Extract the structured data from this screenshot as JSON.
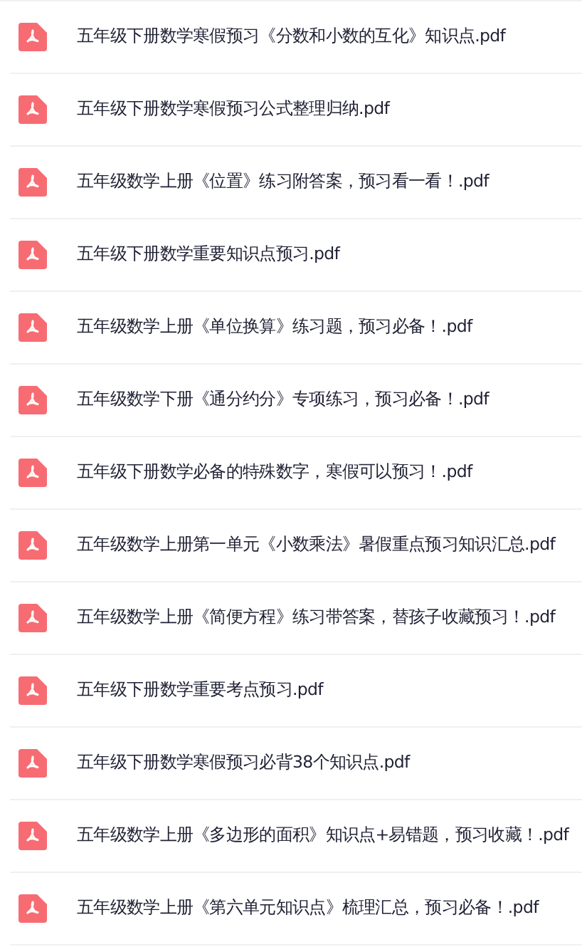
{
  "files": [
    {
      "name": "五年级下册数学寒假预习《分数和小数的互化》知识点.pdf"
    },
    {
      "name": "五年级下册数学寒假预习公式整理归纳.pdf"
    },
    {
      "name": "五年级数学上册《位置》练习附答案，预习看一看！.pdf"
    },
    {
      "name": "五年级下册数学重要知识点预习.pdf"
    },
    {
      "name": "五年级数学上册《单位换算》练习题，预习必备！.pdf"
    },
    {
      "name": "五年级数学下册《通分约分》专项练习，预习必备！.pdf"
    },
    {
      "name": "五年级下册数学必备的特殊数字，寒假可以预习！.pdf"
    },
    {
      "name": "五年级数学上册第一单元《小数乘法》暑假重点预习知识汇总.pdf"
    },
    {
      "name": "五年级数学上册《简便方程》练习带答案，替孩子收藏预习！.pdf"
    },
    {
      "name": "五年级下册数学重要考点预习.pdf"
    },
    {
      "name": "五年级下册数学寒假预习必背38个知识点.pdf"
    },
    {
      "name": "五年级数学上册《多边形的面积》知识点+易错题，预习收藏！.pdf"
    },
    {
      "name": "五年级数学上册《第六单元知识点》梳理汇总，预习必备！.pdf"
    }
  ]
}
